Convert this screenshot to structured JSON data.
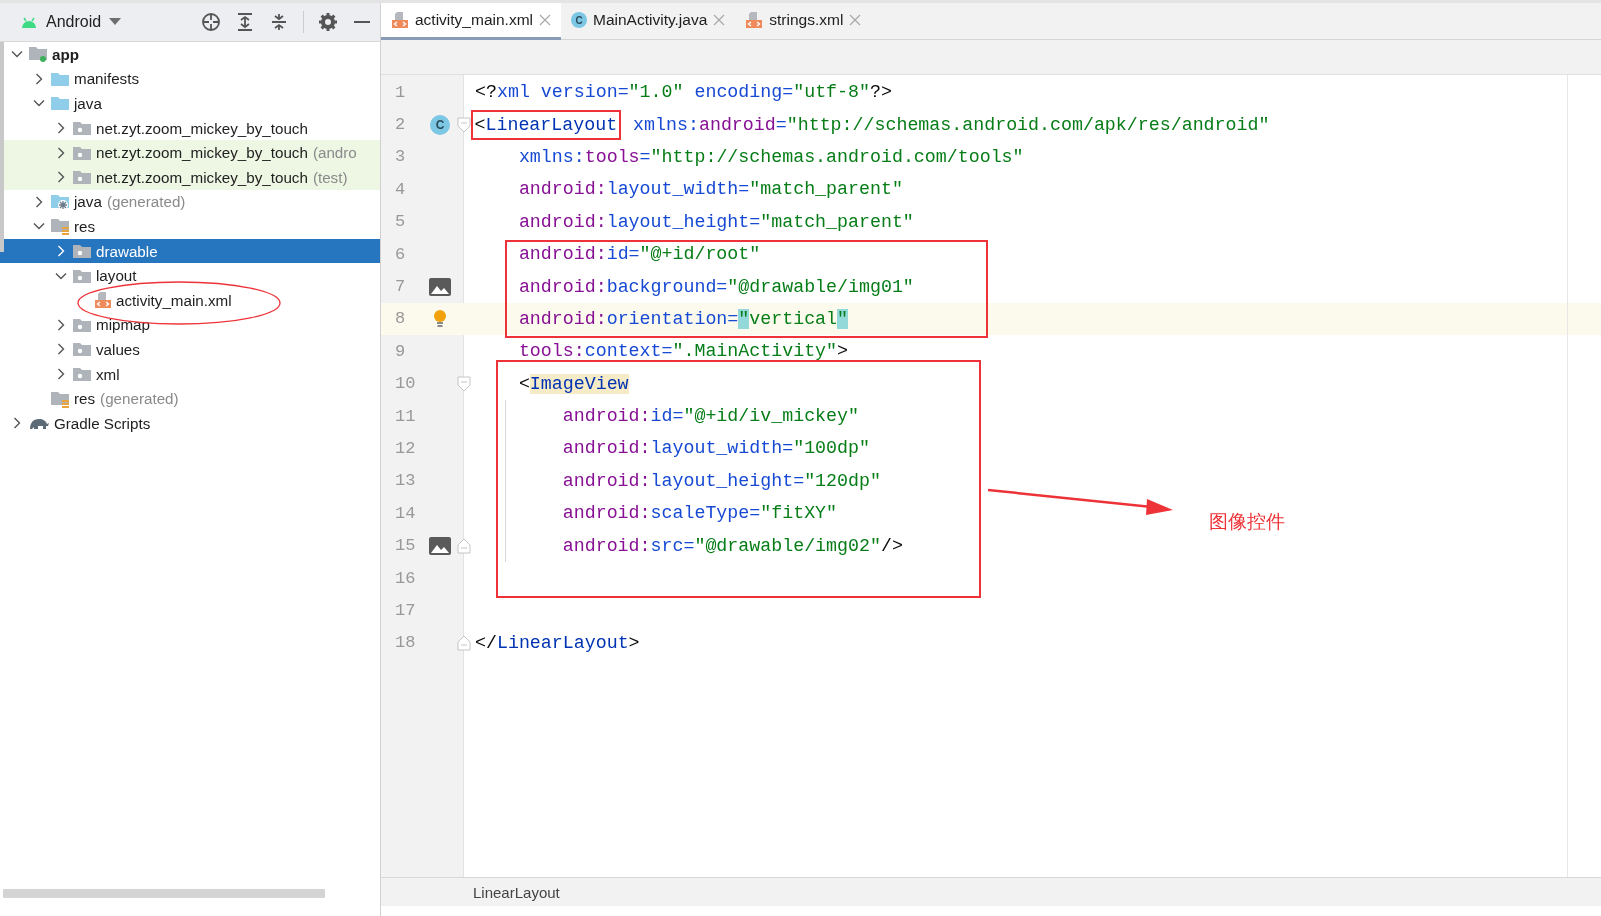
{
  "project": {
    "view": "Android",
    "tree": [
      {
        "label": "app",
        "kind": "module",
        "expanded": true,
        "selected": false,
        "tinted": false,
        "children": [
          {
            "label": "manifests",
            "kind": "folder",
            "expanded": false,
            "selected": false,
            "tinted": false
          },
          {
            "label": "java",
            "kind": "folder",
            "expanded": true,
            "selected": false,
            "tinted": false,
            "children": [
              {
                "label": "net.zyt.zoom_mickey_by_touch",
                "kind": "package",
                "expanded": false,
                "selected": false,
                "tinted": false
              },
              {
                "label": "net.zyt.zoom_mickey_by_touch",
                "suffix": "(andro",
                "kind": "package",
                "expanded": false,
                "selected": false,
                "tinted": true
              },
              {
                "label": "net.zyt.zoom_mickey_by_touch",
                "suffix": "(test)",
                "kind": "package",
                "expanded": false,
                "selected": false,
                "tinted": true
              }
            ]
          },
          {
            "label": "java",
            "suffix": "(generated)",
            "kind": "generated",
            "expanded": false,
            "selected": false,
            "tinted": false
          },
          {
            "label": "res",
            "kind": "resources",
            "expanded": true,
            "selected": false,
            "tinted": false,
            "children": [
              {
                "label": "drawable",
                "kind": "package",
                "expanded": false,
                "selected": true,
                "tinted": false
              },
              {
                "label": "layout",
                "kind": "package",
                "expanded": true,
                "selected": false,
                "tinted": false,
                "children": [
                  {
                    "label": "activity_main.xml",
                    "kind": "xml",
                    "selected": false,
                    "tinted": false
                  }
                ]
              },
              {
                "label": "mipmap",
                "kind": "package",
                "expanded": false,
                "selected": false,
                "tinted": false
              },
              {
                "label": "values",
                "kind": "package",
                "expanded": false,
                "selected": false,
                "tinted": false
              },
              {
                "label": "xml",
                "kind": "package",
                "expanded": false,
                "selected": false,
                "tinted": false
              }
            ]
          },
          {
            "label": "res",
            "suffix": "(generated)",
            "kind": "resources",
            "selected": false,
            "tinted": false
          }
        ]
      },
      {
        "label": "Gradle Scripts",
        "kind": "gradle",
        "expanded": false,
        "selected": false,
        "tinted": false
      }
    ]
  },
  "editor": {
    "tabs": [
      {
        "label": "activity_main.xml",
        "kind": "xml",
        "selected": true
      },
      {
        "label": "MainActivity.java",
        "kind": "class",
        "icon_letter": "C",
        "selected": false
      },
      {
        "label": "strings.xml",
        "kind": "xml",
        "selected": false
      }
    ],
    "lines": [
      {
        "number": "1",
        "kind": "plain",
        "current": false,
        "tokens": [
          {
            "kind": "punct",
            "text": "<?"
          },
          {
            "kind": "attr",
            "text": "xml version="
          },
          {
            "kind": "value",
            "text": "\"1.0\""
          },
          {
            "kind": "attr",
            "text": " encoding="
          },
          {
            "kind": "value",
            "text": "\"utf-8\""
          },
          {
            "kind": "punct",
            "text": "?>"
          }
        ]
      },
      {
        "number": "2",
        "kind": "class-start",
        "marker_text": "C",
        "current": false,
        "tokens": [
          {
            "kind": "punct",
            "text": "<",
            "boxed": true
          },
          {
            "kind": "tag",
            "text": "LinearLayout",
            "boxed": true
          },
          {
            "kind": "attr",
            "text": " xmlns:"
          },
          {
            "kind": "ns",
            "text": "android"
          },
          {
            "kind": "attr",
            "text": "="
          },
          {
            "kind": "value",
            "text": "\"http://schemas.android.com/apk/res/android\""
          }
        ]
      },
      {
        "number": "3",
        "kind": "plain",
        "current": false,
        "tokens": [
          {
            "kind": "attr",
            "text": "    xmlns:"
          },
          {
            "kind": "ns",
            "text": "tools"
          },
          {
            "kind": "attr",
            "text": "="
          },
          {
            "kind": "value",
            "text": "\"http://schemas.android.com/tools\""
          }
        ]
      },
      {
        "number": "4",
        "kind": "plain",
        "current": false,
        "tokens": [
          {
            "kind": "ns",
            "text": "    android:"
          },
          {
            "kind": "attr",
            "text": "layout_width="
          },
          {
            "kind": "value",
            "text": "\"match_parent\""
          }
        ]
      },
      {
        "number": "5",
        "kind": "plain",
        "current": false,
        "tokens": [
          {
            "kind": "ns",
            "text": "    android:"
          },
          {
            "kind": "attr",
            "text": "layout_height="
          },
          {
            "kind": "value",
            "text": "\"match_parent\""
          }
        ]
      },
      {
        "number": "6",
        "kind": "plain",
        "current": false,
        "tokens": [
          {
            "kind": "ns",
            "text": "    android:"
          },
          {
            "kind": "attr",
            "text": "id="
          },
          {
            "kind": "value",
            "text": "\"@+id/root\""
          }
        ]
      },
      {
        "number": "7",
        "kind": "image",
        "current": false,
        "tokens": [
          {
            "kind": "ns",
            "text": "    android:"
          },
          {
            "kind": "attr",
            "text": "background="
          },
          {
            "kind": "value",
            "text": "\"@drawable/img01\""
          }
        ]
      },
      {
        "number": "8",
        "kind": "bulb",
        "current": true,
        "tokens": [
          {
            "kind": "ns",
            "text": "    android:"
          },
          {
            "kind": "attr",
            "text": "orientation="
          },
          {
            "kind": "match",
            "text": "\""
          },
          {
            "kind": "value",
            "text": "vertical"
          },
          {
            "kind": "match",
            "text": "\""
          }
        ]
      },
      {
        "number": "9",
        "kind": "plain",
        "current": false,
        "tokens": [
          {
            "kind": "ns",
            "text": "    tools:"
          },
          {
            "kind": "attr",
            "text": "context="
          },
          {
            "kind": "value",
            "text": "\".MainActivity\""
          },
          {
            "kind": "punct",
            "text": ">"
          }
        ]
      },
      {
        "number": "10",
        "kind": "start",
        "current": false,
        "tokens": [
          {
            "kind": "punct",
            "text": "    <"
          },
          {
            "kind": "tag-match",
            "text": "ImageView"
          }
        ]
      },
      {
        "number": "11",
        "kind": "plain",
        "current": false,
        "guide": true,
        "tokens": [
          {
            "kind": "ns",
            "text": "        android:"
          },
          {
            "kind": "attr",
            "text": "id="
          },
          {
            "kind": "value",
            "text": "\"@+id/iv_mickey\""
          }
        ]
      },
      {
        "number": "12",
        "kind": "plain",
        "current": false,
        "guide": true,
        "tokens": [
          {
            "kind": "ns",
            "text": "        android:"
          },
          {
            "kind": "attr",
            "text": "layout_width="
          },
          {
            "kind": "value",
            "text": "\"100dp\""
          }
        ]
      },
      {
        "number": "13",
        "kind": "plain",
        "current": false,
        "guide": true,
        "tokens": [
          {
            "kind": "ns",
            "text": "        android:"
          },
          {
            "kind": "attr",
            "text": "layout_height="
          },
          {
            "kind": "value",
            "text": "\"120dp\""
          }
        ]
      },
      {
        "number": "14",
        "kind": "plain",
        "current": false,
        "guide": true,
        "tokens": [
          {
            "kind": "ns",
            "text": "        android:"
          },
          {
            "kind": "attr",
            "text": "scaleType="
          },
          {
            "kind": "value",
            "text": "\"fitXY\""
          }
        ]
      },
      {
        "number": "15",
        "kind": "image-end",
        "current": false,
        "guide": true,
        "tokens": [
          {
            "kind": "ns",
            "text": "        android:"
          },
          {
            "kind": "attr",
            "text": "src="
          },
          {
            "kind": "value",
            "text": "\"@drawable/img02\""
          },
          {
            "kind": "punct",
            "text": "/>"
          }
        ]
      },
      {
        "number": "16",
        "kind": "plain",
        "current": false
      },
      {
        "number": "17",
        "kind": "plain",
        "current": false
      },
      {
        "number": "18",
        "kind": "end",
        "current": false,
        "tokens": [
          {
            "kind": "punct",
            "text": "</"
          },
          {
            "kind": "tag",
            "text": "LinearLayout"
          },
          {
            "kind": "punct",
            "text": ">"
          }
        ]
      }
    ],
    "breadcrumb": "LinearLayout"
  },
  "annotations": {
    "label": "图像控件"
  }
}
